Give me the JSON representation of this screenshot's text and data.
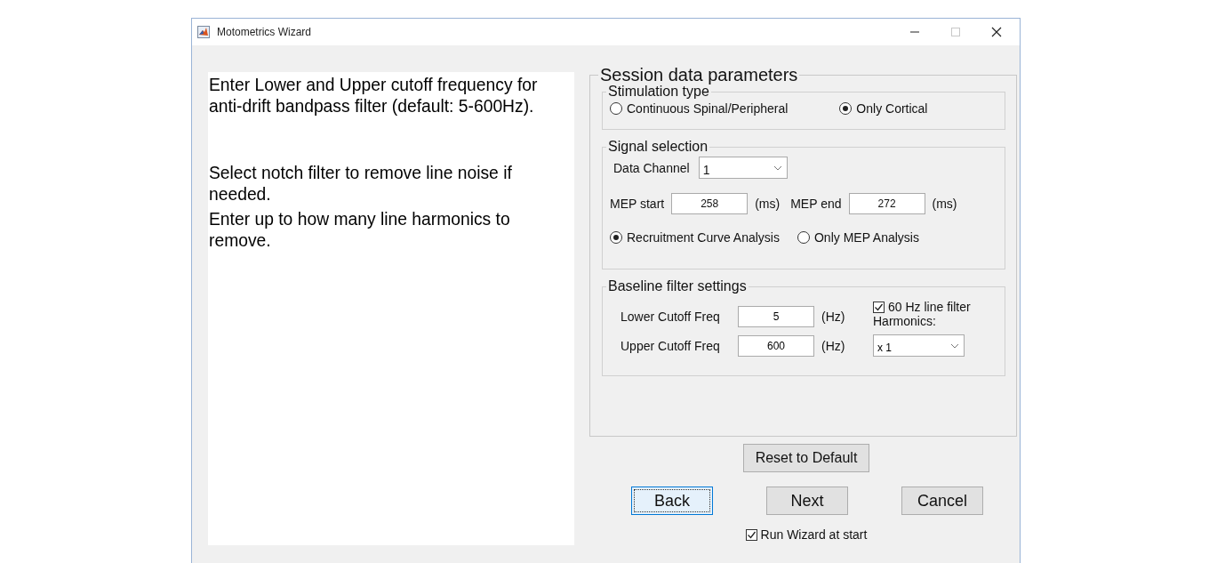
{
  "window": {
    "title": "Motometrics Wizard",
    "controls": [
      {
        "kind": "minimize",
        "disabled": false
      },
      {
        "kind": "maximize",
        "disabled": true
      },
      {
        "kind": "close",
        "disabled": false
      }
    ]
  },
  "instructions": [
    "Enter Lower and Upper cutoff frequency for anti-drift bandpass filter (default: 5-600Hz).",
    "Select notch filter to remove line noise if needed.",
    "Enter up to how many line harmonics to remove."
  ],
  "session": {
    "title": "Session data parameters",
    "stimulation": {
      "title": "Stimulation type",
      "options": [
        {
          "label": "Continuous Spinal/Peripheral",
          "selected": false
        },
        {
          "label": "Only Cortical",
          "selected": true
        }
      ]
    },
    "signal": {
      "title": "Signal selection",
      "channel_label": "Data Channel",
      "channel_value": "1",
      "mep_start_label": "MEP start",
      "mep_start": "258",
      "mep_start_unit": "(ms)",
      "mep_end_label": "MEP end",
      "mep_end": "272",
      "mep_end_unit": "(ms)",
      "analysis": [
        {
          "label": "Recruitment Curve Analysis",
          "selected": true
        },
        {
          "label": "Only MEP Analysis",
          "selected": false
        }
      ]
    },
    "baseline": {
      "title": "Baseline filter settings",
      "lower_label": "Lower Cutoff Freq",
      "lower": "5",
      "lower_unit": "(Hz)",
      "upper_label": "Upper Cutoff Freq",
      "upper": "600",
      "upper_unit": "(Hz)",
      "line_filter": {
        "label": "60 Hz line filter",
        "checked": true
      },
      "harmonics_label": "Harmonics:",
      "harmonics_value": "x 1"
    }
  },
  "reset_button": "Reset to Default",
  "buttons": [
    {
      "label": "Back",
      "focused": true
    },
    {
      "label": "Next",
      "focused": false
    },
    {
      "label": "Cancel",
      "focused": false
    }
  ],
  "run_at_start": {
    "label": "Run Wizard at start",
    "checked": true
  }
}
